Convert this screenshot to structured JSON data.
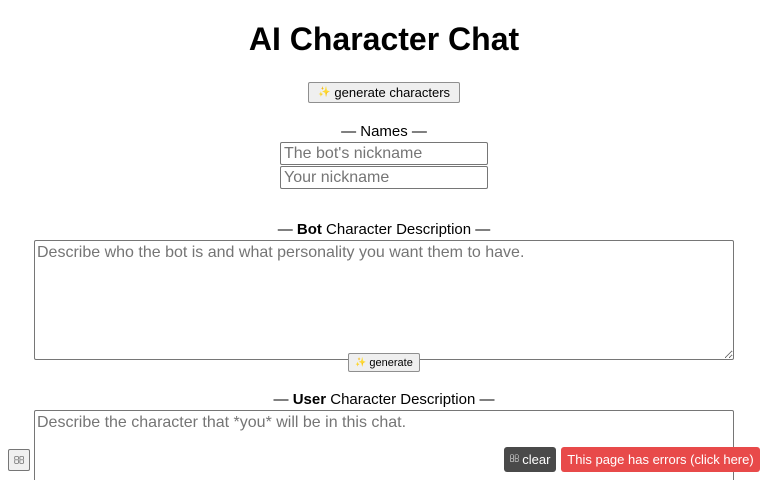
{
  "header": {
    "title": "AI Character Chat"
  },
  "toolbar": {
    "generate_characters_icon": "sparkle-icon",
    "generate_characters_label": "generate characters"
  },
  "names": {
    "label_prefix": "— ",
    "label_text": "Names",
    "label_suffix": " —",
    "bot_nickname_placeholder": "The bot's nickname",
    "bot_nickname_value": "",
    "user_nickname_placeholder": "Your nickname",
    "user_nickname_value": ""
  },
  "bot_description": {
    "label_prefix": "— ",
    "label_bold": "Bot",
    "label_rest": " Character Description —",
    "placeholder": "Describe who the bot is and what personality you want them to have.",
    "value": "",
    "generate_label": "generate"
  },
  "user_description": {
    "label_prefix": "— ",
    "label_bold": "User",
    "label_rest": " Character Description —",
    "placeholder": "Describe the character that *you* will be in this chat.",
    "value": ""
  },
  "footer": {
    "corner_icon": "missing-glyph-icon",
    "clear_icon": "missing-glyph-icon",
    "clear_label": "clear",
    "error_label": "This page has errors (click here)"
  },
  "colors": {
    "error_bg": "#e84a4a",
    "clear_bg": "#4a4a4a"
  }
}
